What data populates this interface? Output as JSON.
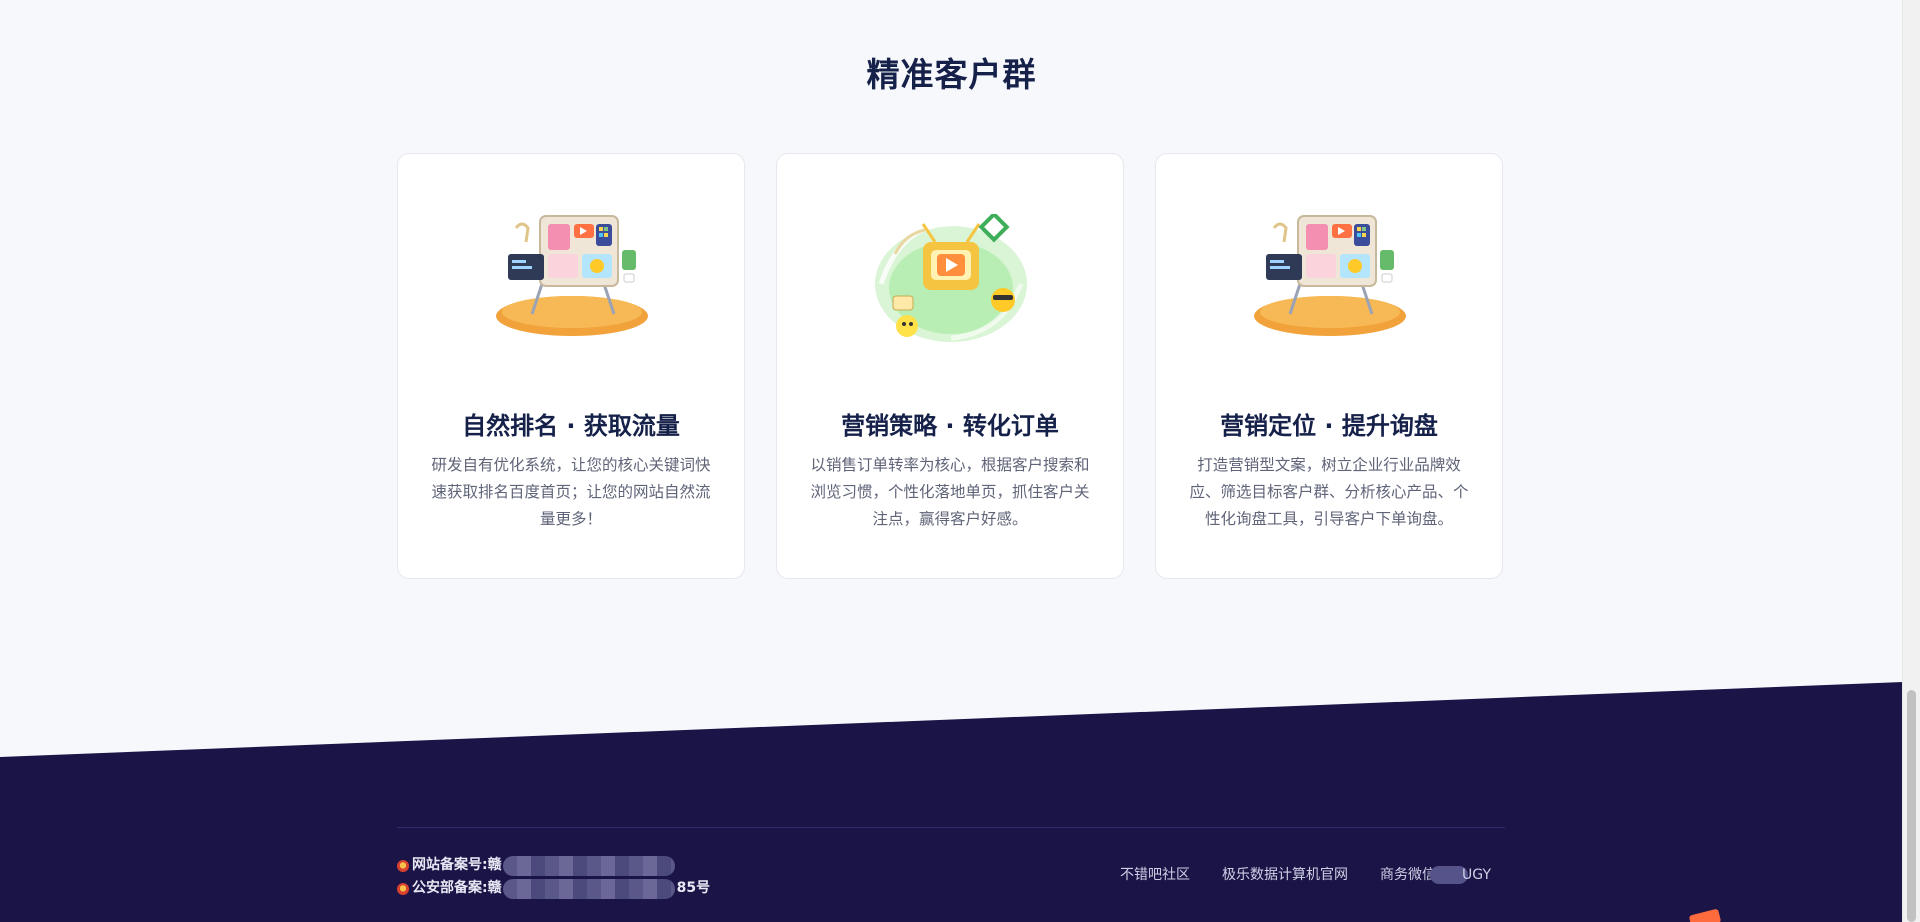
{
  "section": {
    "title": "精准客户群"
  },
  "cards": [
    {
      "title": "自然排名 · 获取流量",
      "description": "研发自有优化系统，让您的核心关键词快速获取排名百度首页；让您的网站自然流量更多！",
      "illustration": "dashboard-board-icon"
    },
    {
      "title": "营销策略 · 转化订单",
      "description": "以销售订单转率为核心，根据客户搜索和浏览习惯，个性化落地单页，抓住客户关注点，赢得客户好感。",
      "illustration": "tv-play-icon"
    },
    {
      "title": "营销定位 · 提升询盘",
      "description": "打造营销型文案，树立企业行业品牌效应、筛选目标客户群、分析核心产品、个性化询盘工具，引导客户下单询盘。",
      "illustration": "dashboard-board-icon"
    }
  ],
  "footer": {
    "background_color": "#1a1447",
    "icp_label": "网站备案号:",
    "icp_prefix": "赣",
    "police_label": "公安部备案:",
    "police_prefix": "赣",
    "police_suffix": "85号",
    "links": [
      "不错吧社区",
      "极乐数据计算机官网"
    ],
    "wechat_prefix": "商务微信",
    "wechat_suffix": "UGY"
  }
}
